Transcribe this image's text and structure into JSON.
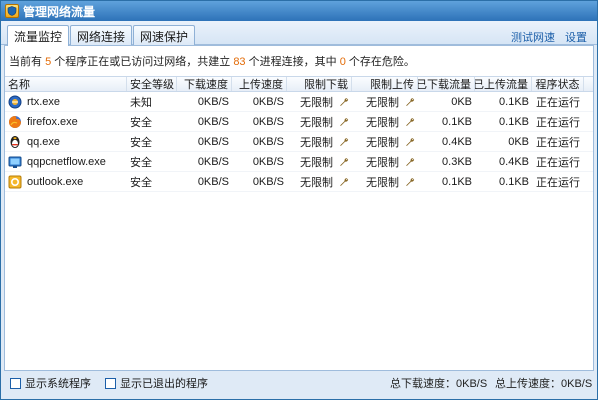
{
  "window": {
    "title": "管理网络流量",
    "icon": "shield-icon"
  },
  "tabs": [
    {
      "label": "流量监控",
      "active": true
    },
    {
      "label": "网络连接",
      "active": false
    },
    {
      "label": "网速保护",
      "active": false
    }
  ],
  "links": {
    "test_speed": "测试网速",
    "settings": "设置"
  },
  "info": {
    "prefix": "当前有",
    "program_count": "5",
    "mid1": "个程序正在或已访问过网络，共建立",
    "connection_count": "83",
    "mid2": "个进程连接，其中",
    "danger_count": "0",
    "suffix": "个存在危险。"
  },
  "table": {
    "headers": {
      "name": "名称",
      "security": "安全等级",
      "download_speed": "下载速度",
      "upload_speed": "上传速度",
      "limit_download": "限制下载",
      "limit_upload": "限制上传",
      "total_downloaded": "已下载流量",
      "total_uploaded": "已上传流量",
      "status": "程序状态"
    },
    "rows": [
      {
        "icon": "rtx-icon",
        "name": "rtx.exe",
        "security": "未知",
        "download_speed": "0KB/S",
        "upload_speed": "0KB/S",
        "limit_download": "无限制",
        "limit_upload": "无限制",
        "total_downloaded": "0KB",
        "total_uploaded": "0.1KB",
        "status": "正在运行"
      },
      {
        "icon": "firefox-icon",
        "name": "firefox.exe",
        "security": "安全",
        "download_speed": "0KB/S",
        "upload_speed": "0KB/S",
        "limit_download": "无限制",
        "limit_upload": "无限制",
        "total_downloaded": "0.1KB",
        "total_uploaded": "0.1KB",
        "status": "正在运行"
      },
      {
        "icon": "qq-icon",
        "name": "qq.exe",
        "security": "安全",
        "download_speed": "0KB/S",
        "upload_speed": "0KB/S",
        "limit_download": "无限制",
        "limit_upload": "无限制",
        "total_downloaded": "0.4KB",
        "total_uploaded": "0KB",
        "status": "正在运行"
      },
      {
        "icon": "qqpcnetflow-icon",
        "name": "qqpcnetflow.exe",
        "security": "安全",
        "download_speed": "0KB/S",
        "upload_speed": "0KB/S",
        "limit_download": "无限制",
        "limit_upload": "无限制",
        "total_downloaded": "0.3KB",
        "total_uploaded": "0.4KB",
        "status": "正在运行"
      },
      {
        "icon": "outlook-icon",
        "name": "outlook.exe",
        "security": "安全",
        "download_speed": "0KB/S",
        "upload_speed": "0KB/S",
        "limit_download": "无限制",
        "limit_upload": "无限制",
        "total_downloaded": "0.1KB",
        "total_uploaded": "0.1KB",
        "status": "正在运行"
      }
    ]
  },
  "footer": {
    "show_system": "显示系统程序",
    "show_exited": "显示已退出的程序",
    "total_download_label": "总下载速度：",
    "total_download_value": "0KB/S",
    "total_upload_label": "总上传速度：",
    "total_upload_value": "0KB/S"
  },
  "colors": {
    "accent": "#2d72b8",
    "highlight_number": "#e36c09",
    "link": "#1c5fa9"
  }
}
